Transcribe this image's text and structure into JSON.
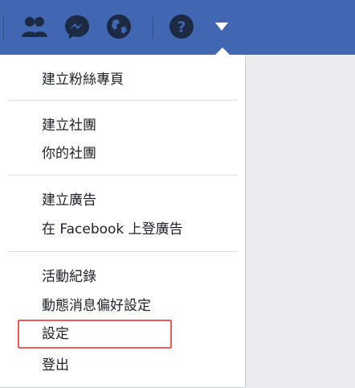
{
  "topbar": {
    "icons": [
      "friends-icon",
      "messenger-icon",
      "globe-notifications-icon",
      "help-icon",
      "dropdown-arrow-icon"
    ],
    "bg_color": "#4267b2"
  },
  "menu": {
    "group1": [
      "建立粉絲專頁"
    ],
    "group2": [
      "建立社團",
      "你的社團"
    ],
    "group3": [
      "建立廣告",
      "在 Facebook 上登廣告"
    ],
    "group4": [
      "活動紀錄",
      "動態消息偏好設定",
      "設定",
      "登出"
    ]
  },
  "highlight_color": "#f05a5a"
}
